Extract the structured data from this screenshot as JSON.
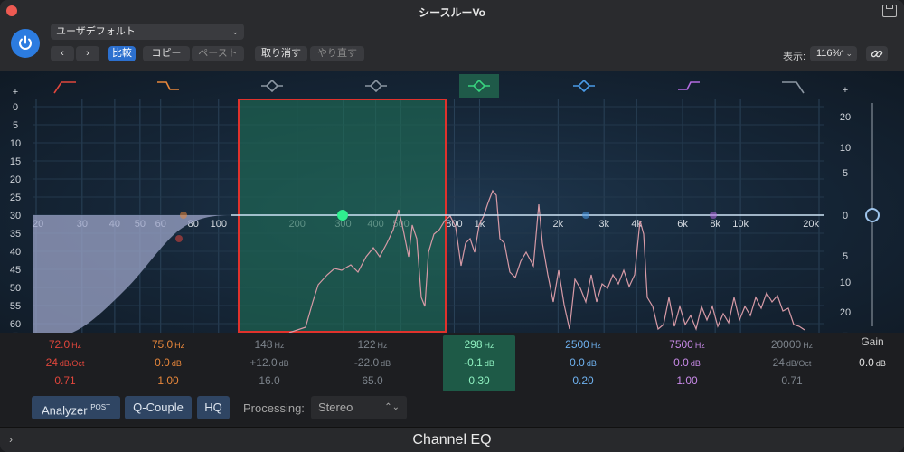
{
  "window": {
    "title": "シースルーVo",
    "footer_name": "Channel EQ",
    "footer_arrow": "›"
  },
  "header": {
    "preset": "ユーザデフォルト",
    "preset_chevron": "⌄",
    "prev": "‹",
    "next": "›",
    "compare": "比較",
    "copy": "コピー",
    "paste": "ペースト",
    "undo": "取り消す",
    "redo": "やり直す",
    "zoom_label": "表示:",
    "zoom_value": "116%",
    "zoom_chevron": "⌃⌄"
  },
  "graph": {
    "left_scale": [
      "+",
      "0",
      "5",
      "10",
      "15",
      "20",
      "25",
      "30",
      "35",
      "40",
      "45",
      "50",
      "55",
      "60",
      "−"
    ],
    "right_scale": [
      "+",
      "20",
      "10",
      "5",
      "0",
      "5",
      "10",
      "20",
      "−"
    ],
    "freq_labels": [
      "20",
      "30",
      "40",
      "50",
      "60",
      "80",
      "100",
      "200",
      "300",
      "400",
      "500",
      "800",
      "1k",
      "2k",
      "3k",
      "4k",
      "6k",
      "8k",
      "10k",
      "20k"
    ],
    "band_icons": [
      "low-cut-icon",
      "low-shelf-icon",
      "bell-icon",
      "bell-icon",
      "bell-icon",
      "bell-icon",
      "high-shelf-icon",
      "high-cut-icon"
    ],
    "band_colors": [
      "#e0463c",
      "#e8873b",
      "#8c97a3",
      "#8c97a3",
      "#39d47f",
      "#4a9be8",
      "#b36ae0",
      "#8c97a3"
    ]
  },
  "bands": [
    {
      "freq": "72.0",
      "freq_unit": "Hz",
      "gain": "24",
      "gain_unit": "dB/Oct",
      "q": "0.71",
      "color": "#e0463c"
    },
    {
      "freq": "75.0",
      "freq_unit": "Hz",
      "gain": "0.0",
      "gain_unit": "dB",
      "q": "1.00",
      "color": "#e8873b"
    },
    {
      "freq": "148",
      "freq_unit": "Hz",
      "gain": "+12.0",
      "gain_unit": "dB",
      "q": "16.0",
      "color": "#7d848c"
    },
    {
      "freq": "122",
      "freq_unit": "Hz",
      "gain": "-22.0",
      "gain_unit": "dB",
      "q": "65.0",
      "color": "#7d848c"
    },
    {
      "freq": "298",
      "freq_unit": "Hz",
      "gain": "-0.1",
      "gain_unit": "dB",
      "q": "0.30",
      "color": "#8ff0c0"
    },
    {
      "freq": "2500",
      "freq_unit": "Hz",
      "gain": "0.0",
      "gain_unit": "dB",
      "q": "0.20",
      "color": "#6fb2f0"
    },
    {
      "freq": "7500",
      "freq_unit": "Hz",
      "gain": "0.0",
      "gain_unit": "dB",
      "q": "1.00",
      "color": "#c88ae8"
    },
    {
      "freq": "20000",
      "freq_unit": "Hz",
      "gain": "24",
      "gain_unit": "dB/Oct",
      "q": "0.71",
      "color": "#7d848c"
    }
  ],
  "gain": {
    "label": "Gain",
    "value": "0.0",
    "unit": "dB"
  },
  "bottom": {
    "analyzer": "Analyzer",
    "analyzer_sup": "POST",
    "qcouple": "Q-Couple",
    "hq": "HQ",
    "processing_label": "Processing:",
    "processing_value": "Stereo",
    "processing_chevron": "⌃⌄"
  }
}
